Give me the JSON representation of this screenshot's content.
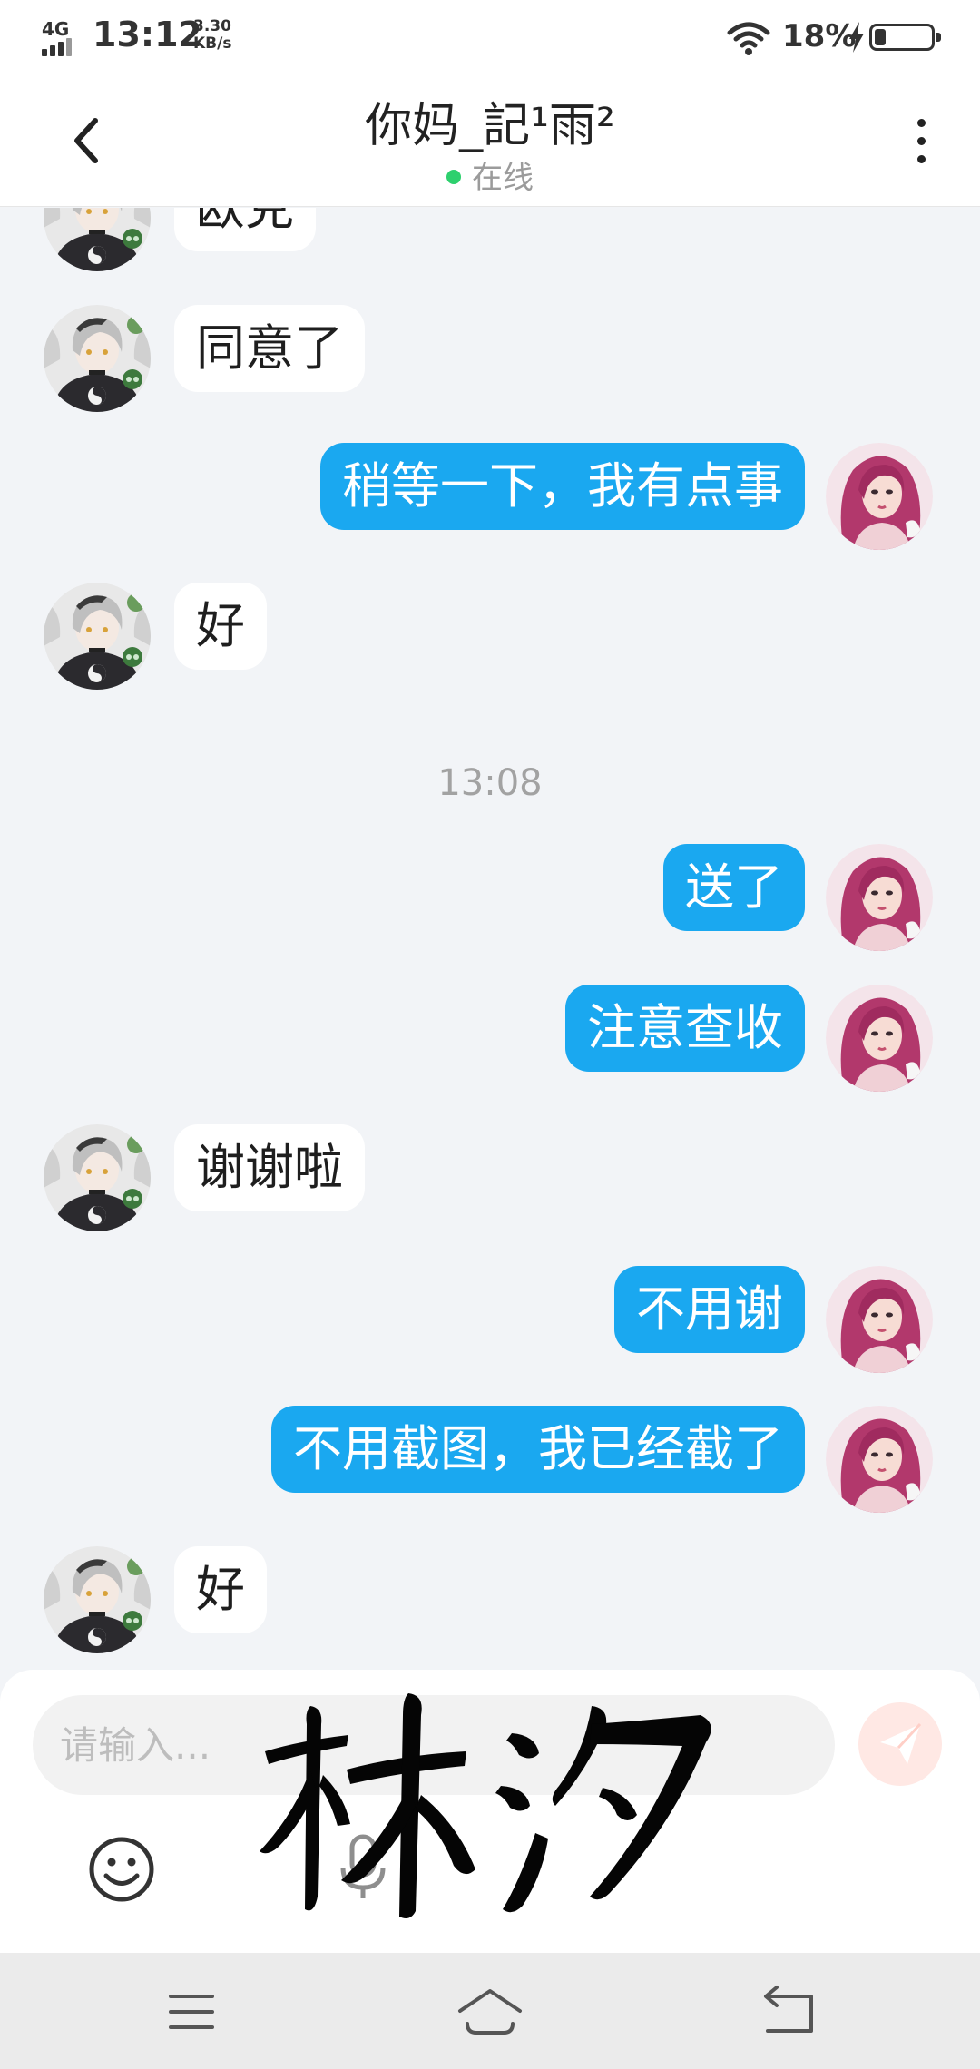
{
  "status_bar": {
    "network": "4G",
    "time": "13:12",
    "speed_value": "3.30",
    "speed_unit": "KB/s",
    "battery": "18%",
    "battery_level": 0.18
  },
  "header": {
    "title": "你妈_記¹雨²",
    "status": "在线"
  },
  "messages": [
    {
      "side": "in",
      "text": "欧克"
    },
    {
      "side": "in",
      "text": "同意了"
    },
    {
      "side": "out",
      "text": "稍等一下，我有点事"
    },
    {
      "side": "in",
      "text": "好"
    },
    {
      "timestamp": "13:08"
    },
    {
      "side": "out",
      "text": "送了"
    },
    {
      "side": "out",
      "text": "注意查收"
    },
    {
      "side": "in",
      "text": "谢谢啦"
    },
    {
      "side": "out",
      "text": "不用谢"
    },
    {
      "side": "out",
      "text": "不用截图，我已经截了"
    },
    {
      "side": "in",
      "text": "好"
    }
  ],
  "input": {
    "placeholder": "请输入..."
  },
  "watermark": "林汐",
  "icons": {
    "back": "chevron-left-icon",
    "more": "more-vertical-icon",
    "send": "send-icon",
    "emoji": "emoji-icon",
    "mic": "mic-icon",
    "nav_menu": "menu-icon",
    "nav_home": "home-icon",
    "nav_back": "back-arrow-icon"
  },
  "colors": {
    "outgoing_bubble": "#1aa8f0",
    "incoming_bubble": "#ffffff",
    "online_dot": "#2ed06e",
    "send_button": "#ffe8e4"
  }
}
